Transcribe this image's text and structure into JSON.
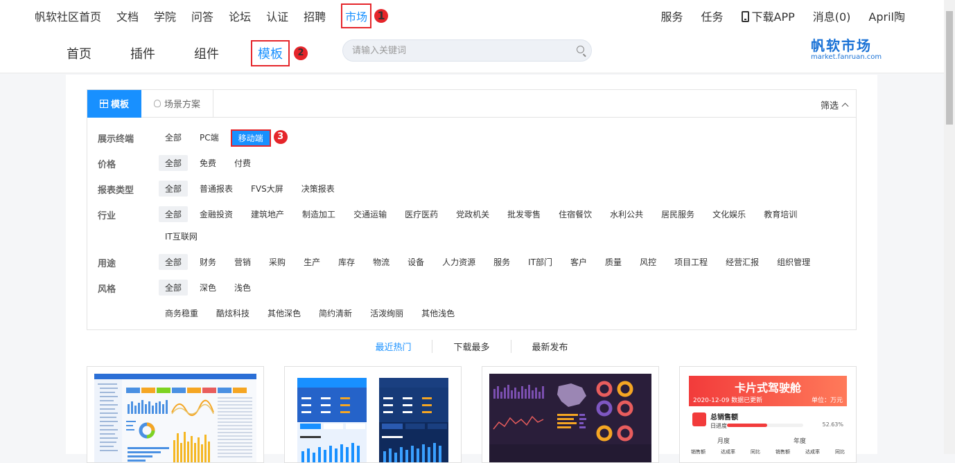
{
  "topnav": {
    "items": [
      "帆软社区首页",
      "文档",
      "学院",
      "问答",
      "论坛",
      "认证",
      "招聘"
    ],
    "market": "市场",
    "right": [
      "服务",
      "任务"
    ],
    "download": "下载APP",
    "messages": "消息(0)",
    "user": "April陶",
    "badge1": "1"
  },
  "subnav": {
    "tabs": [
      "首页",
      "插件",
      "组件"
    ],
    "active": "模板",
    "badge2": "2",
    "search_placeholder": "请输入关键词",
    "logo_title": "帆软市场",
    "logo_url": "market.fanruan.com"
  },
  "filter": {
    "tab_template": "模板",
    "tab_scene": "场景方案",
    "screen": "筛选",
    "badge3": "3",
    "rows": [
      {
        "label": "展示终端",
        "opts": [
          "全部",
          "PC端"
        ],
        "selected": "移动端"
      },
      {
        "label": "价格",
        "opts": [
          "全部",
          "免费",
          "付费"
        ]
      },
      {
        "label": "报表类型",
        "opts": [
          "全部",
          "普通报表",
          "FVS大屏",
          "决策报表"
        ]
      },
      {
        "label": "行业",
        "opts": [
          "全部",
          "金融投资",
          "建筑地产",
          "制造加工",
          "交通运输",
          "医疗医药",
          "党政机关",
          "批发零售",
          "住宿餐饮",
          "水利公共",
          "居民服务",
          "文化娱乐",
          "教育培训"
        ],
        "opts2": [
          "IT互联网"
        ]
      },
      {
        "label": "用途",
        "opts": [
          "全部",
          "财务",
          "营销",
          "采购",
          "生产",
          "库存",
          "物流",
          "设备",
          "人力资源",
          "服务",
          "IT部门",
          "客户",
          "质量",
          "风控",
          "项目工程",
          "经营汇报",
          "组织管理"
        ]
      },
      {
        "label": "风格",
        "opts": [
          "全部",
          "深色",
          "浅色"
        ],
        "opts2": [
          "商务稳重",
          "酷炫科技",
          "其他深色",
          "简约清新",
          "活泼绚丽",
          "其他浅色"
        ]
      }
    ]
  },
  "sort": [
    "最近热门",
    "下载最多",
    "最新发布"
  ],
  "cards": {
    "c4_title": "卡片式驾驶舱",
    "c4_date": "2020-12-09 数据已更新",
    "c4_unit": "单位：万元",
    "c4_total": "总销售额",
    "c4_progress_label": "日进度",
    "c4_progress": "52.63%",
    "c4_month": "月度",
    "c4_year": "年度",
    "c4_cols": [
      "销售额",
      "达成率",
      "同比",
      "销售额",
      "达成率",
      "同比"
    ]
  }
}
